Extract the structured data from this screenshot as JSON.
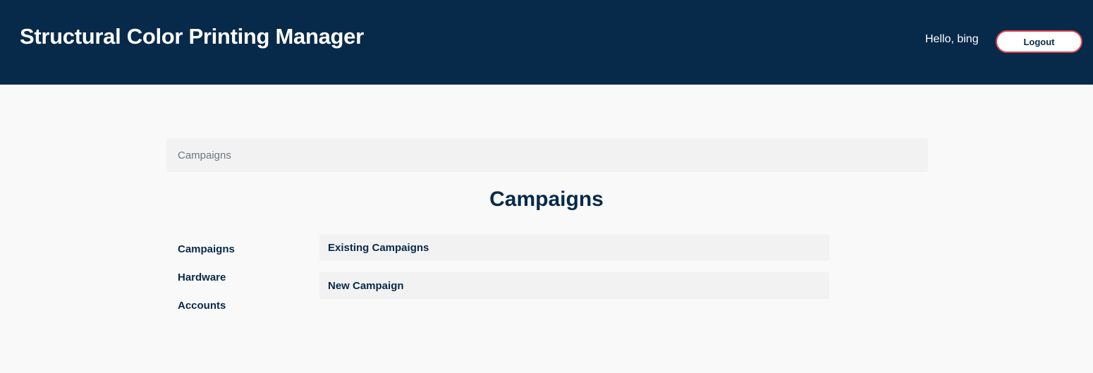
{
  "header": {
    "title": "Structural Color Printing Manager",
    "greeting": "Hello, bing",
    "logout_label": "Logout"
  },
  "breadcrumb": {
    "items": [
      "Campaigns"
    ]
  },
  "page": {
    "title": "Campaigns"
  },
  "sidebar": {
    "items": [
      {
        "label": "Campaigns"
      },
      {
        "label": "Hardware"
      },
      {
        "label": "Accounts"
      }
    ]
  },
  "main": {
    "cards": [
      {
        "label": "Existing Campaigns"
      },
      {
        "label": "New Campaign"
      }
    ]
  },
  "colors": {
    "header_bg": "#072a4a",
    "text_primary": "#082a4a",
    "logout_border": "#e0474c",
    "page_bg": "#f9f9f9",
    "card_bg": "#f2f2f2"
  }
}
